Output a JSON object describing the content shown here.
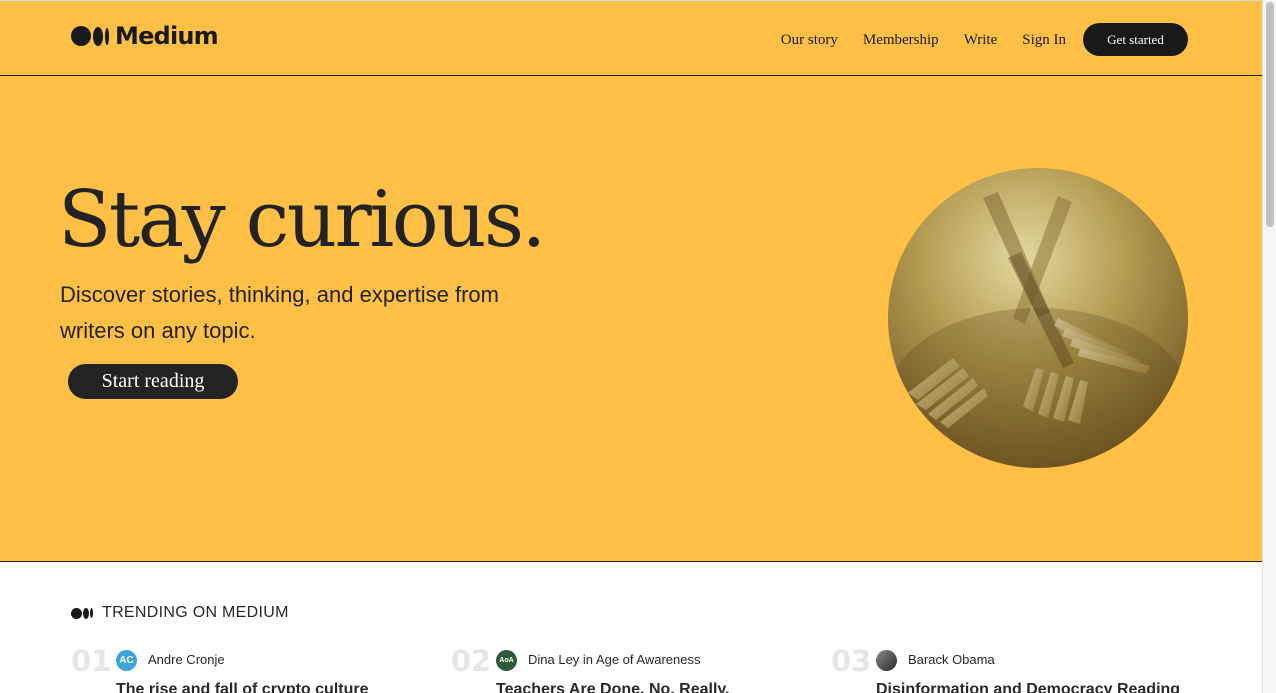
{
  "header": {
    "brand": "Medium",
    "nav": [
      "Our story",
      "Membership",
      "Write",
      "Sign In"
    ],
    "cta": "Get started"
  },
  "hero": {
    "title": "Stay curious.",
    "subtitle": "Discover stories, thinking, and expertise from writers on any topic.",
    "button": "Start reading",
    "image_icon": "forks-image"
  },
  "trending": {
    "label": "TRENDING ON MEDIUM",
    "items": [
      {
        "number": "01",
        "avatar_text": "AC",
        "avatar_color": "#3ba5d8",
        "author": "Andre Cronje",
        "title": "The rise and fall of crypto culture"
      },
      {
        "number": "02",
        "avatar_text": "AoA",
        "avatar_color": "#2e5b3a",
        "author": "Dina Ley in Age of Awareness",
        "title": "Teachers Are Done. No, Really."
      },
      {
        "number": "03",
        "avatar_text": "",
        "avatar_color": "#555555",
        "author": "Barack Obama",
        "title": "Disinformation and Democracy Reading"
      }
    ]
  },
  "colors": {
    "brand_yellow": "#ffc045",
    "dark": "#191919"
  }
}
